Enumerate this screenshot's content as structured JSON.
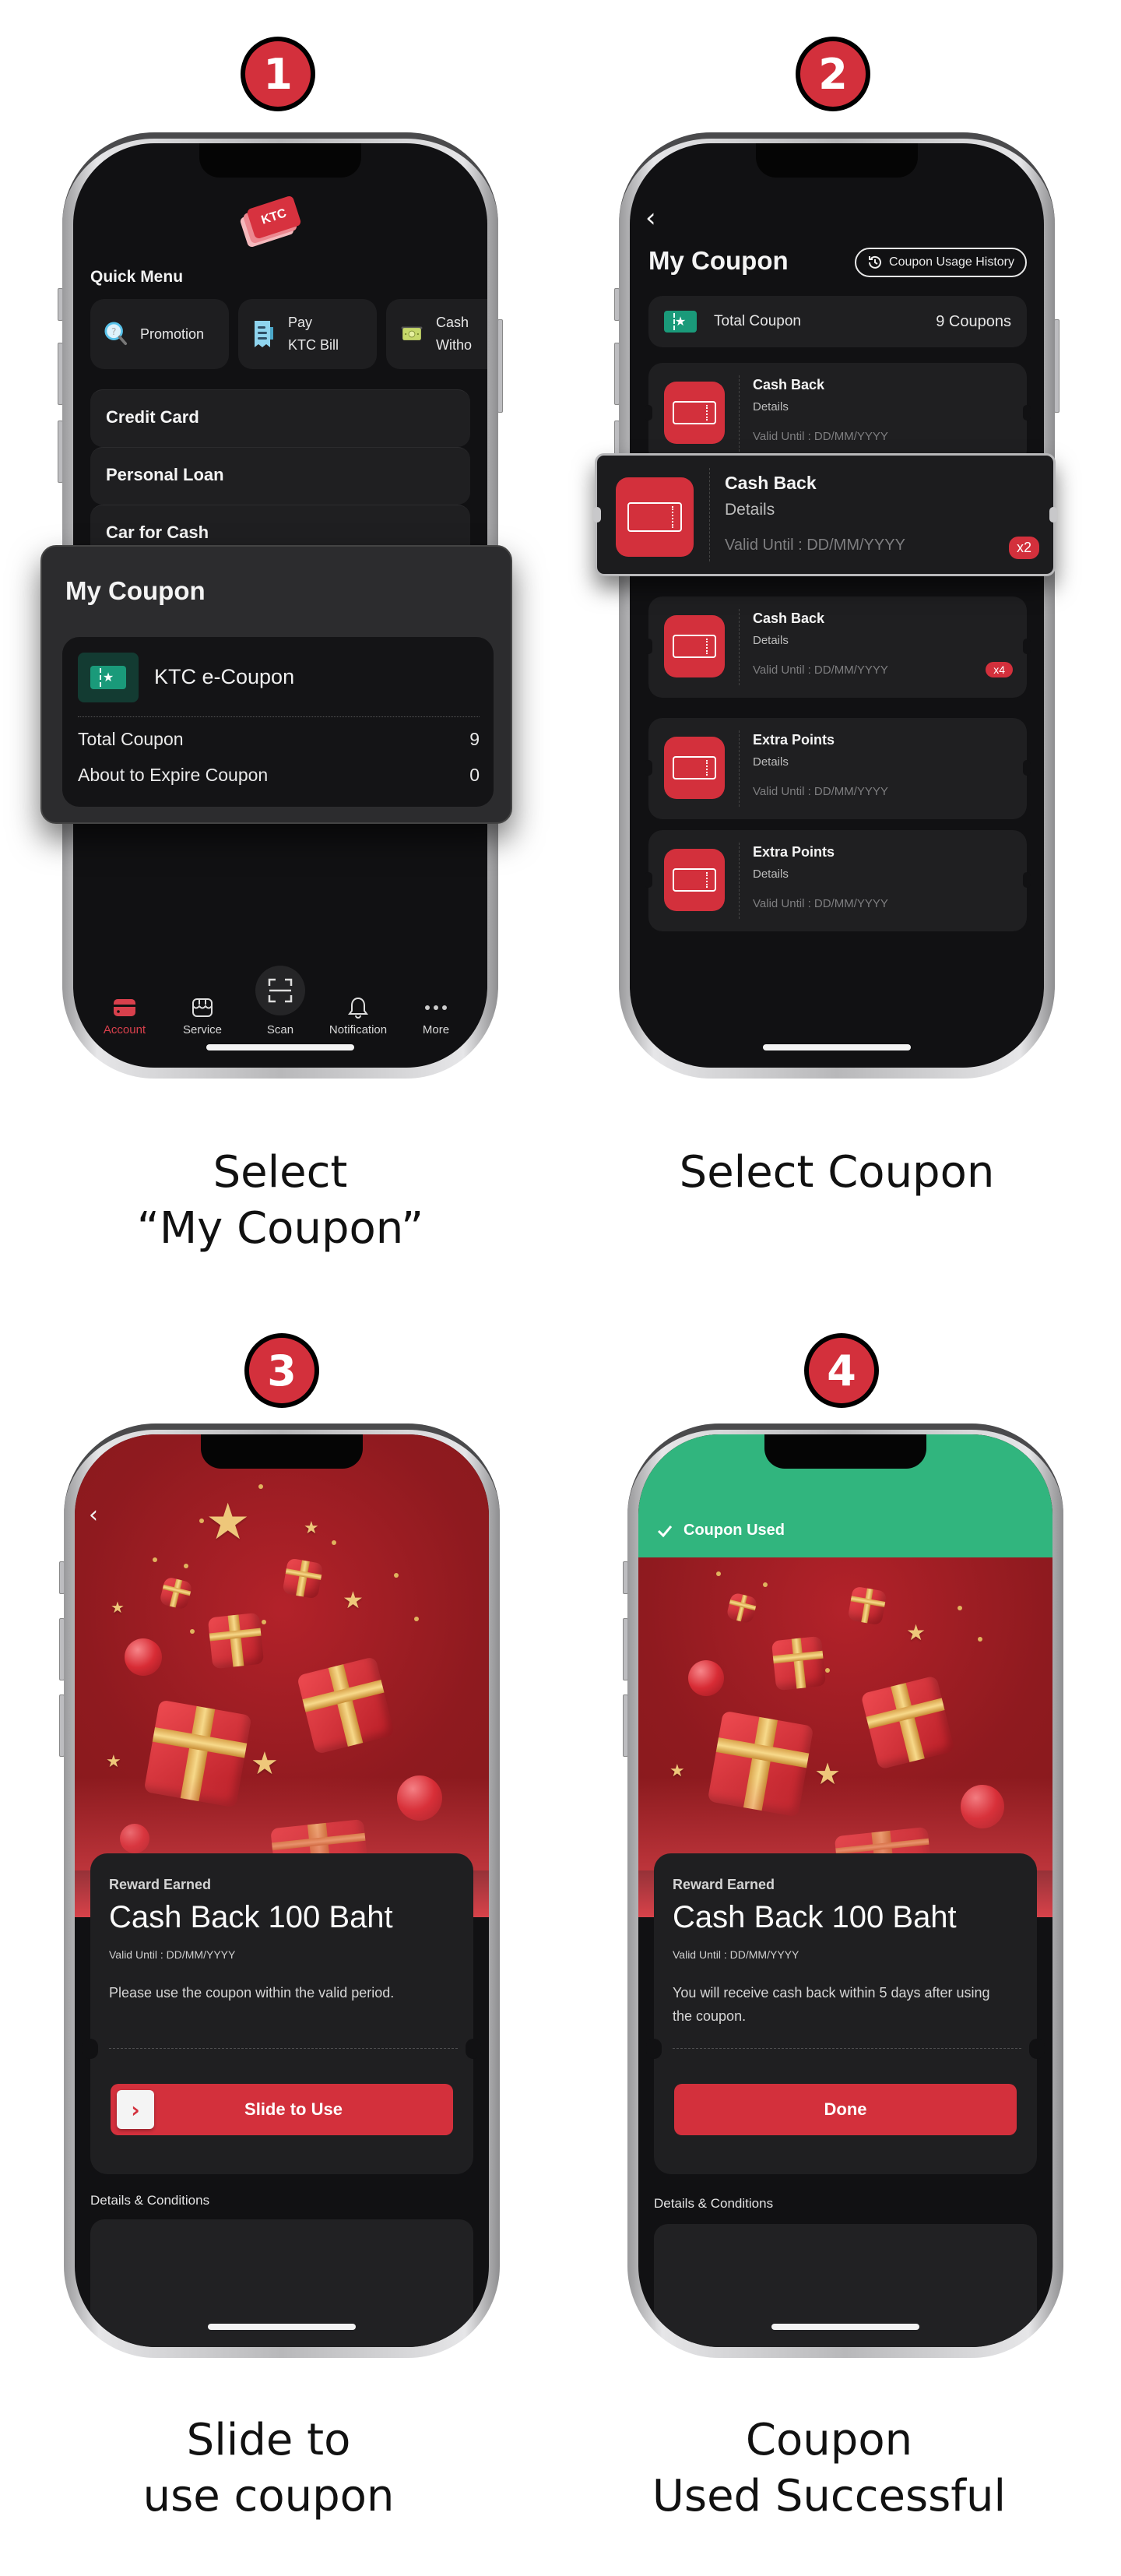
{
  "steps": [
    {
      "number": "1",
      "caption": "Select\n“My Coupon”"
    },
    {
      "number": "2",
      "caption": "Select Coupon"
    },
    {
      "number": "3",
      "caption": "Slide to\nuse coupon"
    },
    {
      "number": "4",
      "caption": "Coupon\nUsed Successful"
    }
  ],
  "colors": {
    "brand_red": "#d3303c",
    "success_green": "#31b57e",
    "screen_bg": "#111113",
    "card_bg": "#1f1f21"
  },
  "screen1": {
    "logo_text": "KTC",
    "quick_menu_title": "Quick Menu",
    "quick_menu": [
      {
        "icon": "search-question-icon",
        "label": "Promotion"
      },
      {
        "icon": "receipt-icon",
        "label": "Pay\nKTC Bill"
      },
      {
        "icon": "cash-icon",
        "label": "Cash\nWitho"
      }
    ],
    "menu_cards": [
      "Credit Card",
      "Personal Loan",
      "Car for Cash"
    ],
    "my_coupon": {
      "title": "My Coupon",
      "name": "KTC e-Coupon",
      "rows": [
        {
          "label": "Total Coupon",
          "value": "9"
        },
        {
          "label": "About to Expire Coupon",
          "value": "0"
        }
      ]
    },
    "bottom_nav": [
      {
        "icon": "card-icon",
        "label": "Account",
        "active": true
      },
      {
        "icon": "store-icon",
        "label": "Service"
      },
      {
        "icon": "scan-icon",
        "label": "Scan"
      },
      {
        "icon": "bell-icon",
        "label": "Notification"
      },
      {
        "icon": "more-icon",
        "label": "More"
      }
    ]
  },
  "screen2": {
    "title": "My Coupon",
    "history_button": "Coupon Usage History",
    "total_label": "Total Coupon",
    "total_value": "9 Coupons",
    "coupons": [
      {
        "title": "Cash Back",
        "details": "Details",
        "valid": "Valid Until : DD/MM/YYYY",
        "qty": ""
      },
      {
        "title": "Cash Back",
        "details": "Details",
        "valid": "Valid Until : DD/MM/YYYY",
        "qty": "x2",
        "selected": true
      },
      {
        "title": "Cash Back",
        "details": "Details",
        "valid": "Valid Until : DD/MM/YYYY",
        "qty": "x4"
      },
      {
        "title": "Extra Points",
        "details": "Details",
        "valid": "Valid Until : DD/MM/YYYY",
        "qty": ""
      },
      {
        "title": "Extra Points",
        "details": "Details",
        "valid": "Valid Until : DD/MM/YYYY",
        "qty": ""
      }
    ]
  },
  "screen3": {
    "reward_label": "Reward Earned",
    "reward_title": "Cash Back 100 Baht",
    "valid": "Valid Until : DD/MM/YYYY",
    "description": "Please use the coupon within the valid period.",
    "action": "Slide to Use",
    "details_conditions": "Details & Conditions"
  },
  "screen4": {
    "banner": "Coupon Used",
    "reward_label": "Reward Earned",
    "reward_title": "Cash Back 100 Baht",
    "valid": "Valid Until : DD/MM/YYYY",
    "description": "You will receive cash back within 5 days after using the coupon.",
    "action": "Done",
    "details_conditions": "Details & Conditions"
  }
}
